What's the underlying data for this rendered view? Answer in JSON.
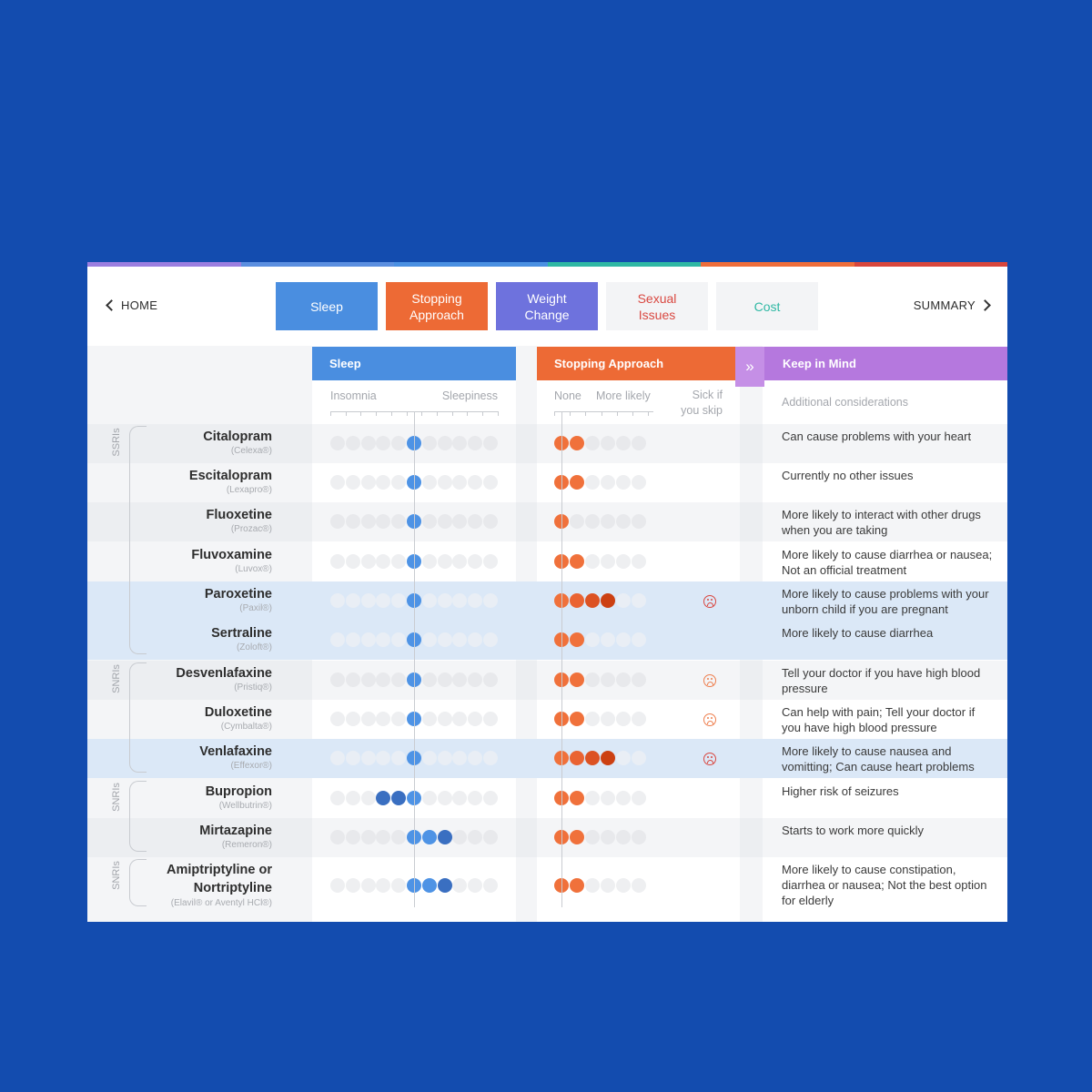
{
  "nav": {
    "home": "HOME",
    "summary": "SUMMARY"
  },
  "tabs": [
    {
      "label": "Sleep",
      "bg": "#4a8ee0",
      "color": "#ffffff"
    },
    {
      "label": "Stopping Approach",
      "bg": "#ed6a35",
      "color": "#ffffff"
    },
    {
      "label": "Weight Change",
      "bg": "#6e72dd",
      "color": "#ffffff"
    },
    {
      "label": "Sexual Issues",
      "bg": "#f3f4f6",
      "color": "#d94841"
    },
    {
      "label": "Cost",
      "bg": "#f3f4f6",
      "color": "#2fb8a4"
    }
  ],
  "colors": {
    "sleep": "#4a8ee0",
    "stopping": "#ed6a35",
    "keep": "#b578de",
    "topbar": [
      "#9b7ee0",
      "#5b8fe0",
      "#4a90e2",
      "#2fb8a4",
      "#ee6d3a",
      "#d8463c"
    ],
    "sleep_dot": "#4e93e5",
    "sleep_dark": "#3a6fc1",
    "stop_light": "#f0713b",
    "stop_dark": "#cc4012",
    "face_red": "#d94841",
    "face_orange": "#ee7f4f"
  },
  "columns": {
    "sleep": {
      "title": "Sleep",
      "low": "Insomnia",
      "high": "Sleepiness"
    },
    "stopping": {
      "title": "Stopping Approach",
      "low": "None",
      "high": "More likely",
      "skip": "Sick if you skip"
    },
    "keep": {
      "title": "Keep in Mind",
      "sub": "Additional considerations"
    }
  },
  "groups": [
    {
      "label": "SSRIs",
      "first": 0,
      "last": 5
    },
    {
      "label": "SNRIs",
      "first": 6,
      "last": 8
    },
    {
      "label": "SNRIs",
      "first": 9,
      "last": 10
    },
    {
      "label": "SNRIs",
      "first": 11,
      "last": 11
    }
  ],
  "rows": [
    {
      "name": "Citalopram",
      "brand": "(Celexa®)",
      "sleep": [
        5
      ],
      "sleep_dark": [],
      "stop": 2,
      "face": "",
      "note": "Can cause problems with your heart",
      "highlight": false
    },
    {
      "name": "Escitalopram",
      "brand": "(Lexapro®)",
      "sleep": [
        5
      ],
      "sleep_dark": [],
      "stop": 2,
      "face": "",
      "note": "Currently no other issues",
      "highlight": false
    },
    {
      "name": "Fluoxetine",
      "brand": "(Prozac®)",
      "sleep": [
        5
      ],
      "sleep_dark": [],
      "stop": 1,
      "face": "",
      "note": "More likely to interact with other drugs when you are taking",
      "highlight": false
    },
    {
      "name": "Fluvoxamine",
      "brand": "(Luvox®)",
      "sleep": [
        5
      ],
      "sleep_dark": [],
      "stop": 2,
      "face": "",
      "note": "More likely to cause diarrhea or nausea; Not an official treatment",
      "highlight": false
    },
    {
      "name": "Paroxetine",
      "brand": "(Paxil®)",
      "sleep": [
        5
      ],
      "sleep_dark": [],
      "stop": 4,
      "face": "red",
      "note": "More likely to cause problems with your unborn child if you are pregnant",
      "highlight": true
    },
    {
      "name": "Sertraline",
      "brand": "(Zoloft®)",
      "sleep": [
        5
      ],
      "sleep_dark": [],
      "stop": 2,
      "face": "",
      "note": "More likely to cause diarrhea",
      "highlight": true
    },
    {
      "name": "Desvenlafaxine",
      "brand": "(Pristiq®)",
      "sleep": [
        5
      ],
      "sleep_dark": [],
      "stop": 2,
      "face": "orange",
      "note": "Tell your doctor if you have high blood pressure",
      "highlight": false
    },
    {
      "name": "Duloxetine",
      "brand": "(Cymbalta®)",
      "sleep": [
        5
      ],
      "sleep_dark": [],
      "stop": 2,
      "face": "orange",
      "note": "Can help with pain; Tell your doctor if you have high blood pressure",
      "highlight": false
    },
    {
      "name": "Venlafaxine",
      "brand": "(Effexor®)",
      "sleep": [
        5
      ],
      "sleep_dark": [],
      "stop": 4,
      "face": "red",
      "note": "More likely to cause nausea and vomitting; Can cause heart problems",
      "highlight": true
    },
    {
      "name": "Bupropion",
      "brand": "(Wellbutrin®)",
      "sleep": [
        5
      ],
      "sleep_dark": [
        3,
        4
      ],
      "stop": 2,
      "face": "",
      "note": "Higher risk of seizures",
      "highlight": false
    },
    {
      "name": "Mirtazapine",
      "brand": "(Remeron®)",
      "sleep": [
        5,
        6
      ],
      "sleep_dark": [
        7
      ],
      "stop": 2,
      "face": "",
      "note": "Starts to work more quickly",
      "highlight": false
    },
    {
      "name": "Amiptriptyline or Nortriptyline",
      "brand": "(Elavil® or Aventyl HCl®)",
      "sleep": [
        5,
        6
      ],
      "sleep_dark": [
        7
      ],
      "stop": 2,
      "face": "",
      "note": "More likely to cause constipation, diarrhea or nausea; Not the best option for elderly",
      "highlight": false
    }
  ]
}
